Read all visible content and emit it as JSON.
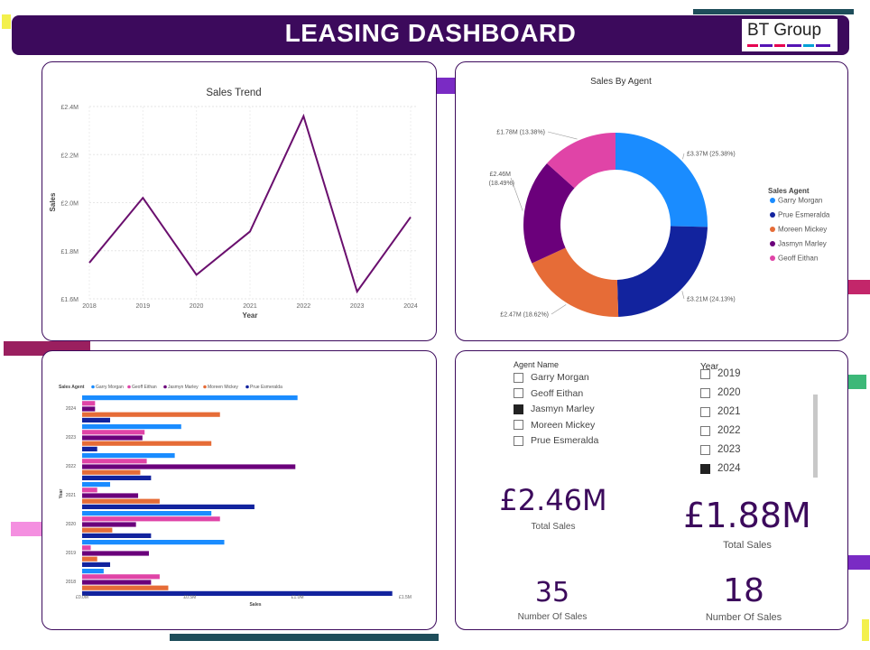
{
  "header": {
    "title": "LEASING DASHBOARD",
    "logo_text": "BT Group"
  },
  "colors": {
    "header_bg": "#3c0a5c",
    "line": "#6a0f6e",
    "agents": {
      "Garry Morgan": "#1a8cff",
      "Prue Esmeralda": "#12239e",
      "Moreen Mickey": "#e66c37",
      "Jasmyn Marley": "#6b007b",
      "Geoff Eithan": "#e044a7"
    }
  },
  "line_chart": {
    "chart_data": {
      "type": "line",
      "title": "Sales Trend",
      "xlabel": "Year",
      "ylabel": "Sales",
      "x": [
        "2018",
        "2019",
        "2020",
        "2021",
        "2022",
        "2023",
        "2024"
      ],
      "values": [
        1.75,
        2.02,
        1.7,
        1.88,
        2.36,
        1.63,
        1.94
      ],
      "ylim": [
        1.6,
        2.4
      ],
      "yticks": [
        "£1.6M",
        "£1.8M",
        "£2.0M",
        "£2.2M",
        "£2.4M"
      ],
      "grid": true
    }
  },
  "donut_chart": {
    "chart_data": {
      "type": "pie",
      "title": "Sales By Agent",
      "legend_title": "Sales Agent",
      "legend_position": "right",
      "slices": [
        {
          "name": "Garry Morgan",
          "value": 25.38,
          "label": "£3.37M (25.38%)"
        },
        {
          "name": "Prue Esmeralda",
          "value": 24.13,
          "label": "£3.21M (24.13%)"
        },
        {
          "name": "Moreen Mickey",
          "value": 18.62,
          "label": "£2.47M (18.62%)"
        },
        {
          "name": "Jasmyn Marley",
          "value": 18.49,
          "label_line1": "£2.46M",
          "label_line2": "(18.49%)"
        },
        {
          "name": "Geoff Eithan",
          "value": 13.38,
          "label": "£1.78M (13.38%)"
        }
      ]
    }
  },
  "bar_chart": {
    "chart_data": {
      "type": "bar",
      "orientation": "horizontal",
      "legend_title": "Sales Agent",
      "legend_position": "top-left",
      "xlabel": "Sales",
      "ylabel": "Year",
      "categories": [
        "2024",
        "2023",
        "2022",
        "2021",
        "2020",
        "2019",
        "2018"
      ],
      "xlim": [
        0,
        1.5
      ],
      "xticks": [
        "£0.0M",
        "£0.5M",
        "£1.0M",
        "£1.5M"
      ],
      "series": [
        {
          "name": "Garry Morgan",
          "values": [
            1.0,
            0.46,
            0.43,
            0.13,
            0.6,
            0.66,
            0.1
          ]
        },
        {
          "name": "Geoff Eithan",
          "values": [
            0.06,
            0.29,
            0.3,
            0.07,
            0.64,
            0.04,
            0.36
          ]
        },
        {
          "name": "Jasmyn Marley",
          "values": [
            0.06,
            0.28,
            0.99,
            0.26,
            0.25,
            0.31,
            0.32
          ]
        },
        {
          "name": "Moreen Mickey",
          "values": [
            0.64,
            0.6,
            0.27,
            0.36,
            0.14,
            0.07,
            0.4
          ]
        },
        {
          "name": "Prue Esmeralda",
          "values": [
            0.13,
            0.07,
            0.32,
            0.8,
            0.32,
            0.13,
            1.44
          ]
        }
      ]
    }
  },
  "agent_slicer": {
    "title": "Agent Name",
    "items": [
      {
        "label": "Garry Morgan",
        "checked": false
      },
      {
        "label": "Geoff Eithan",
        "checked": false
      },
      {
        "label": "Jasmyn Marley",
        "checked": true
      },
      {
        "label": "Moreen Mickey",
        "checked": false
      },
      {
        "label": "Prue Esmeralda",
        "checked": false
      }
    ]
  },
  "year_slicer": {
    "title": "Year",
    "items": [
      {
        "label": "2019",
        "checked": false
      },
      {
        "label": "2020",
        "checked": false
      },
      {
        "label": "2021",
        "checked": false
      },
      {
        "label": "2022",
        "checked": false
      },
      {
        "label": "2023",
        "checked": false
      },
      {
        "label": "2024",
        "checked": true
      }
    ]
  },
  "kpis": {
    "total_sales_left": {
      "value": "£2.46M",
      "label": "Total Sales"
    },
    "total_sales_right": {
      "value": "£1.88M",
      "label": "Total Sales"
    },
    "count_left": {
      "value": "35",
      "label": "Number Of Sales"
    },
    "count_right": {
      "value": "18",
      "label": "Number Of Sales"
    }
  }
}
